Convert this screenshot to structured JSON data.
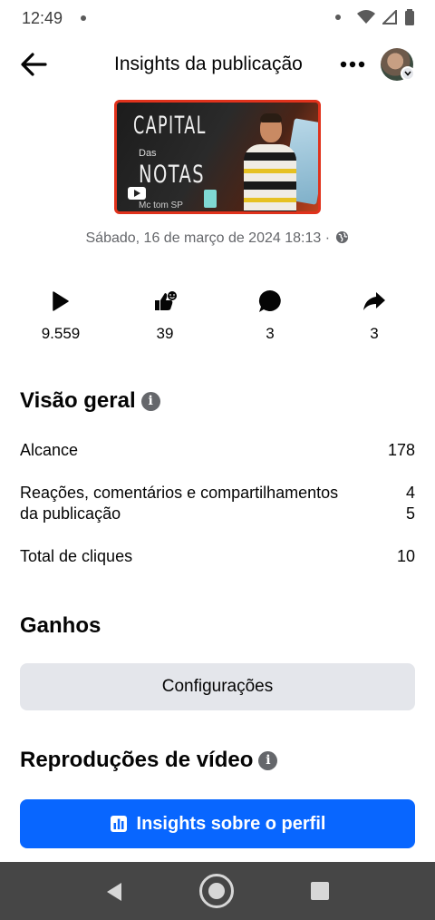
{
  "status_bar": {
    "time": "12:49"
  },
  "header": {
    "title": "Insights da publicação",
    "back_icon": "arrow-left-icon",
    "more_icon": "more-horizontal-icon"
  },
  "post": {
    "thumbnail_title_line1": "CAPITAL",
    "thumbnail_title_das": "Das",
    "thumbnail_title_line2": "NOTAS",
    "thumbnail_subtitle": "Mc tom SP",
    "date": "Sábado, 16 de março de 2024 18:13 ·",
    "privacy_icon": "globe-icon"
  },
  "stats": [
    {
      "icon": "play-icon",
      "value": "9.559"
    },
    {
      "icon": "reactions-icon",
      "value": "39"
    },
    {
      "icon": "comment-icon",
      "value": "3"
    },
    {
      "icon": "share-icon",
      "value": "3"
    }
  ],
  "overview": {
    "title": "Visão geral",
    "info_icon": "info-icon",
    "metrics": [
      {
        "label": "Alcance",
        "value": "178"
      },
      {
        "label_line1": "Reações, comentários e compartilhamentos",
        "label_line2": "da publicação",
        "value_line1": "4",
        "value_line2": "5"
      },
      {
        "label": "Total de cliques",
        "value": "10"
      }
    ]
  },
  "earnings": {
    "title": "Ganhos",
    "button_label": "Configurações"
  },
  "video_plays": {
    "title": "Reproduções de vídeo",
    "info_icon": "info-icon"
  },
  "profile_insights": {
    "button_label": "Insights sobre o perfil",
    "icon": "bar-chart-icon"
  },
  "colors": {
    "primary_blue": "#0866ff",
    "secondary_button": "#e4e6eb",
    "text_secondary": "#65676b",
    "thumbnail_border": "#e0321c",
    "nav_bar": "#464646"
  }
}
